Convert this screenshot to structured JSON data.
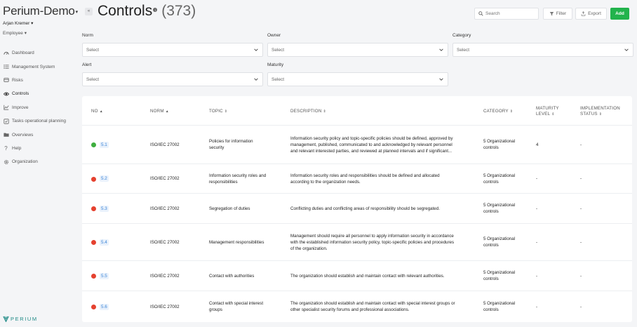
{
  "sidebar": {
    "org": "Perium-Demo",
    "user": "Arjan Kremer",
    "role": "Employee",
    "items": [
      {
        "label": "Dashboard",
        "icon": "dashboard-icon"
      },
      {
        "label": "Management System",
        "icon": "list-icon"
      },
      {
        "label": "Risks",
        "icon": "risks-icon"
      },
      {
        "label": "Controls",
        "icon": "eye-icon"
      },
      {
        "label": "Improve",
        "icon": "chart-icon"
      },
      {
        "label": "Tasks operational planning",
        "icon": "tasks-icon"
      },
      {
        "label": "Overviews",
        "icon": "folder-icon"
      },
      {
        "label": "Help",
        "icon": "help-icon"
      },
      {
        "label": "Organization",
        "icon": "gear-icon"
      }
    ],
    "logo_text": "PERIUM"
  },
  "header": {
    "toggle": "«",
    "title": "Controls",
    "info": "i",
    "count": "(373)",
    "search_placeholder": "Search",
    "filter_label": "Filter",
    "export_label": "Export",
    "add_label": "Add"
  },
  "filters": {
    "norm": {
      "label": "Norm",
      "value": "Select"
    },
    "owner": {
      "label": "Owner",
      "value": "Select"
    },
    "category": {
      "label": "Category",
      "value": "Select"
    },
    "alert": {
      "label": "Alert",
      "value": "Select"
    },
    "maturity": {
      "label": "Maturity",
      "value": "Select"
    }
  },
  "table": {
    "columns": {
      "no": "NO",
      "norm": "NORM",
      "topic": "TOPIC",
      "description": "DESCRIPTION",
      "category": "CATEGORY",
      "maturity_1": "MATURITY",
      "maturity_2": "LEVEL",
      "impl_1": "IMPLEMENTATION",
      "impl_2": "STATUS"
    },
    "rows": [
      {
        "status_color": "#3fae3f",
        "no": "5.1",
        "norm": "ISO/IEC 27002",
        "topic_1": "Policies for information",
        "topic_2": "security",
        "desc_1": "Information security policy and topic-specific policies should be defined, approved by",
        "desc_2": "management, published, communicated to and acknowledged by relevant personnel",
        "desc_3": "and relevant interested parties, and reviewed at planned intervals and if significant...",
        "cat_1": "5 Organizational",
        "cat_2": "controls",
        "maturity": "4",
        "impl": "-"
      },
      {
        "status_color": "#e5412f",
        "no": "5.2",
        "norm": "ISO/IEC 27002",
        "topic_1": "Information security roles and",
        "topic_2": "responsibilities",
        "desc_1": "Information security roles and responsibilities should be defined and allocated",
        "desc_2": "according to the organization needs.",
        "desc_3": "",
        "cat_1": "5 Organizational",
        "cat_2": "controls",
        "maturity": "-",
        "impl": "-"
      },
      {
        "status_color": "#e5412f",
        "no": "5.3",
        "norm": "ISO/IEC 27002",
        "topic_1": "Segregation of duties",
        "topic_2": "",
        "desc_1": "Conflicting duties and conflicting areas of responsibility should be segregated.",
        "desc_2": "",
        "desc_3": "",
        "cat_1": "5 Organizational",
        "cat_2": "controls",
        "maturity": "-",
        "impl": "-"
      },
      {
        "status_color": "#e5412f",
        "no": "5.4",
        "norm": "ISO/IEC 27002",
        "topic_1": "Management responsibilities",
        "topic_2": "",
        "desc_1": "Management should require all personnel to apply information security in accordance",
        "desc_2": "with the established information security policy, topic-specific policies and procedures",
        "desc_3": "of the organization.",
        "cat_1": "5 Organizational",
        "cat_2": "controls",
        "maturity": "-",
        "impl": "-"
      },
      {
        "status_color": "#e5412f",
        "no": "5.5",
        "norm": "ISO/IEC 27002",
        "topic_1": "Contact with authorities",
        "topic_2": "",
        "desc_1": "The organization should establish and maintain contact with relevant authorities.",
        "desc_2": "",
        "desc_3": "",
        "cat_1": "5 Organizational",
        "cat_2": "controls",
        "maturity": "-",
        "impl": "-"
      },
      {
        "status_color": "#e5412f",
        "no": "5.6",
        "norm": "ISO/IEC 27002",
        "topic_1": "Contact with special interest",
        "topic_2": "groups",
        "desc_1": "The organization should establish and maintain contact with special interest groups or",
        "desc_2": "other specialist security forums and professional associations.",
        "desc_3": "",
        "cat_1": "5 Organizational",
        "cat_2": "controls",
        "maturity": "-",
        "impl": "-"
      }
    ]
  }
}
